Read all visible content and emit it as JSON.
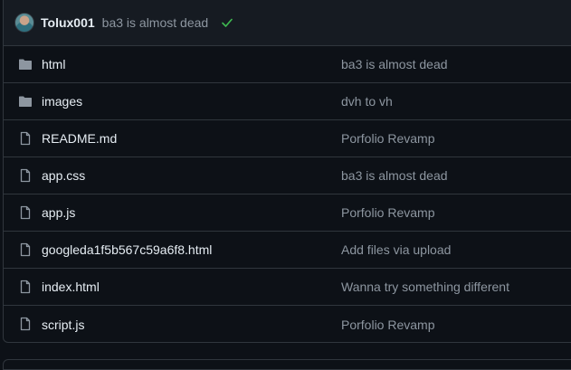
{
  "latest_commit": {
    "author": "Tolux001",
    "message": "ba3 is almost dead",
    "status_icon": "check-icon",
    "status_color": "#3fb950"
  },
  "files": [
    {
      "name": "html",
      "type": "directory",
      "icon": "folder-icon",
      "commit": "ba3 is almost dead"
    },
    {
      "name": "images",
      "type": "directory",
      "icon": "folder-icon",
      "commit": "dvh to vh"
    },
    {
      "name": "README.md",
      "type": "file",
      "icon": "file-icon",
      "commit": "Porfolio Revamp"
    },
    {
      "name": "app.css",
      "type": "file",
      "icon": "file-icon",
      "commit": "ba3 is almost dead"
    },
    {
      "name": "app.js",
      "type": "file",
      "icon": "file-icon",
      "commit": "Porfolio Revamp"
    },
    {
      "name": "googleda1f5b567c59a6f8.html",
      "type": "file",
      "icon": "file-icon",
      "commit": "Add files via upload"
    },
    {
      "name": "index.html",
      "type": "file",
      "icon": "file-icon",
      "commit": "Wanna try something different"
    },
    {
      "name": "script.js",
      "type": "file",
      "icon": "file-icon",
      "commit": "Porfolio Revamp"
    }
  ],
  "colors": {
    "background": "#0d1117",
    "header_background": "#161b22",
    "border": "#30363d",
    "text": "#e6edf3",
    "muted_text": "#8d96a0",
    "folder_icon": "#8d96a0"
  }
}
